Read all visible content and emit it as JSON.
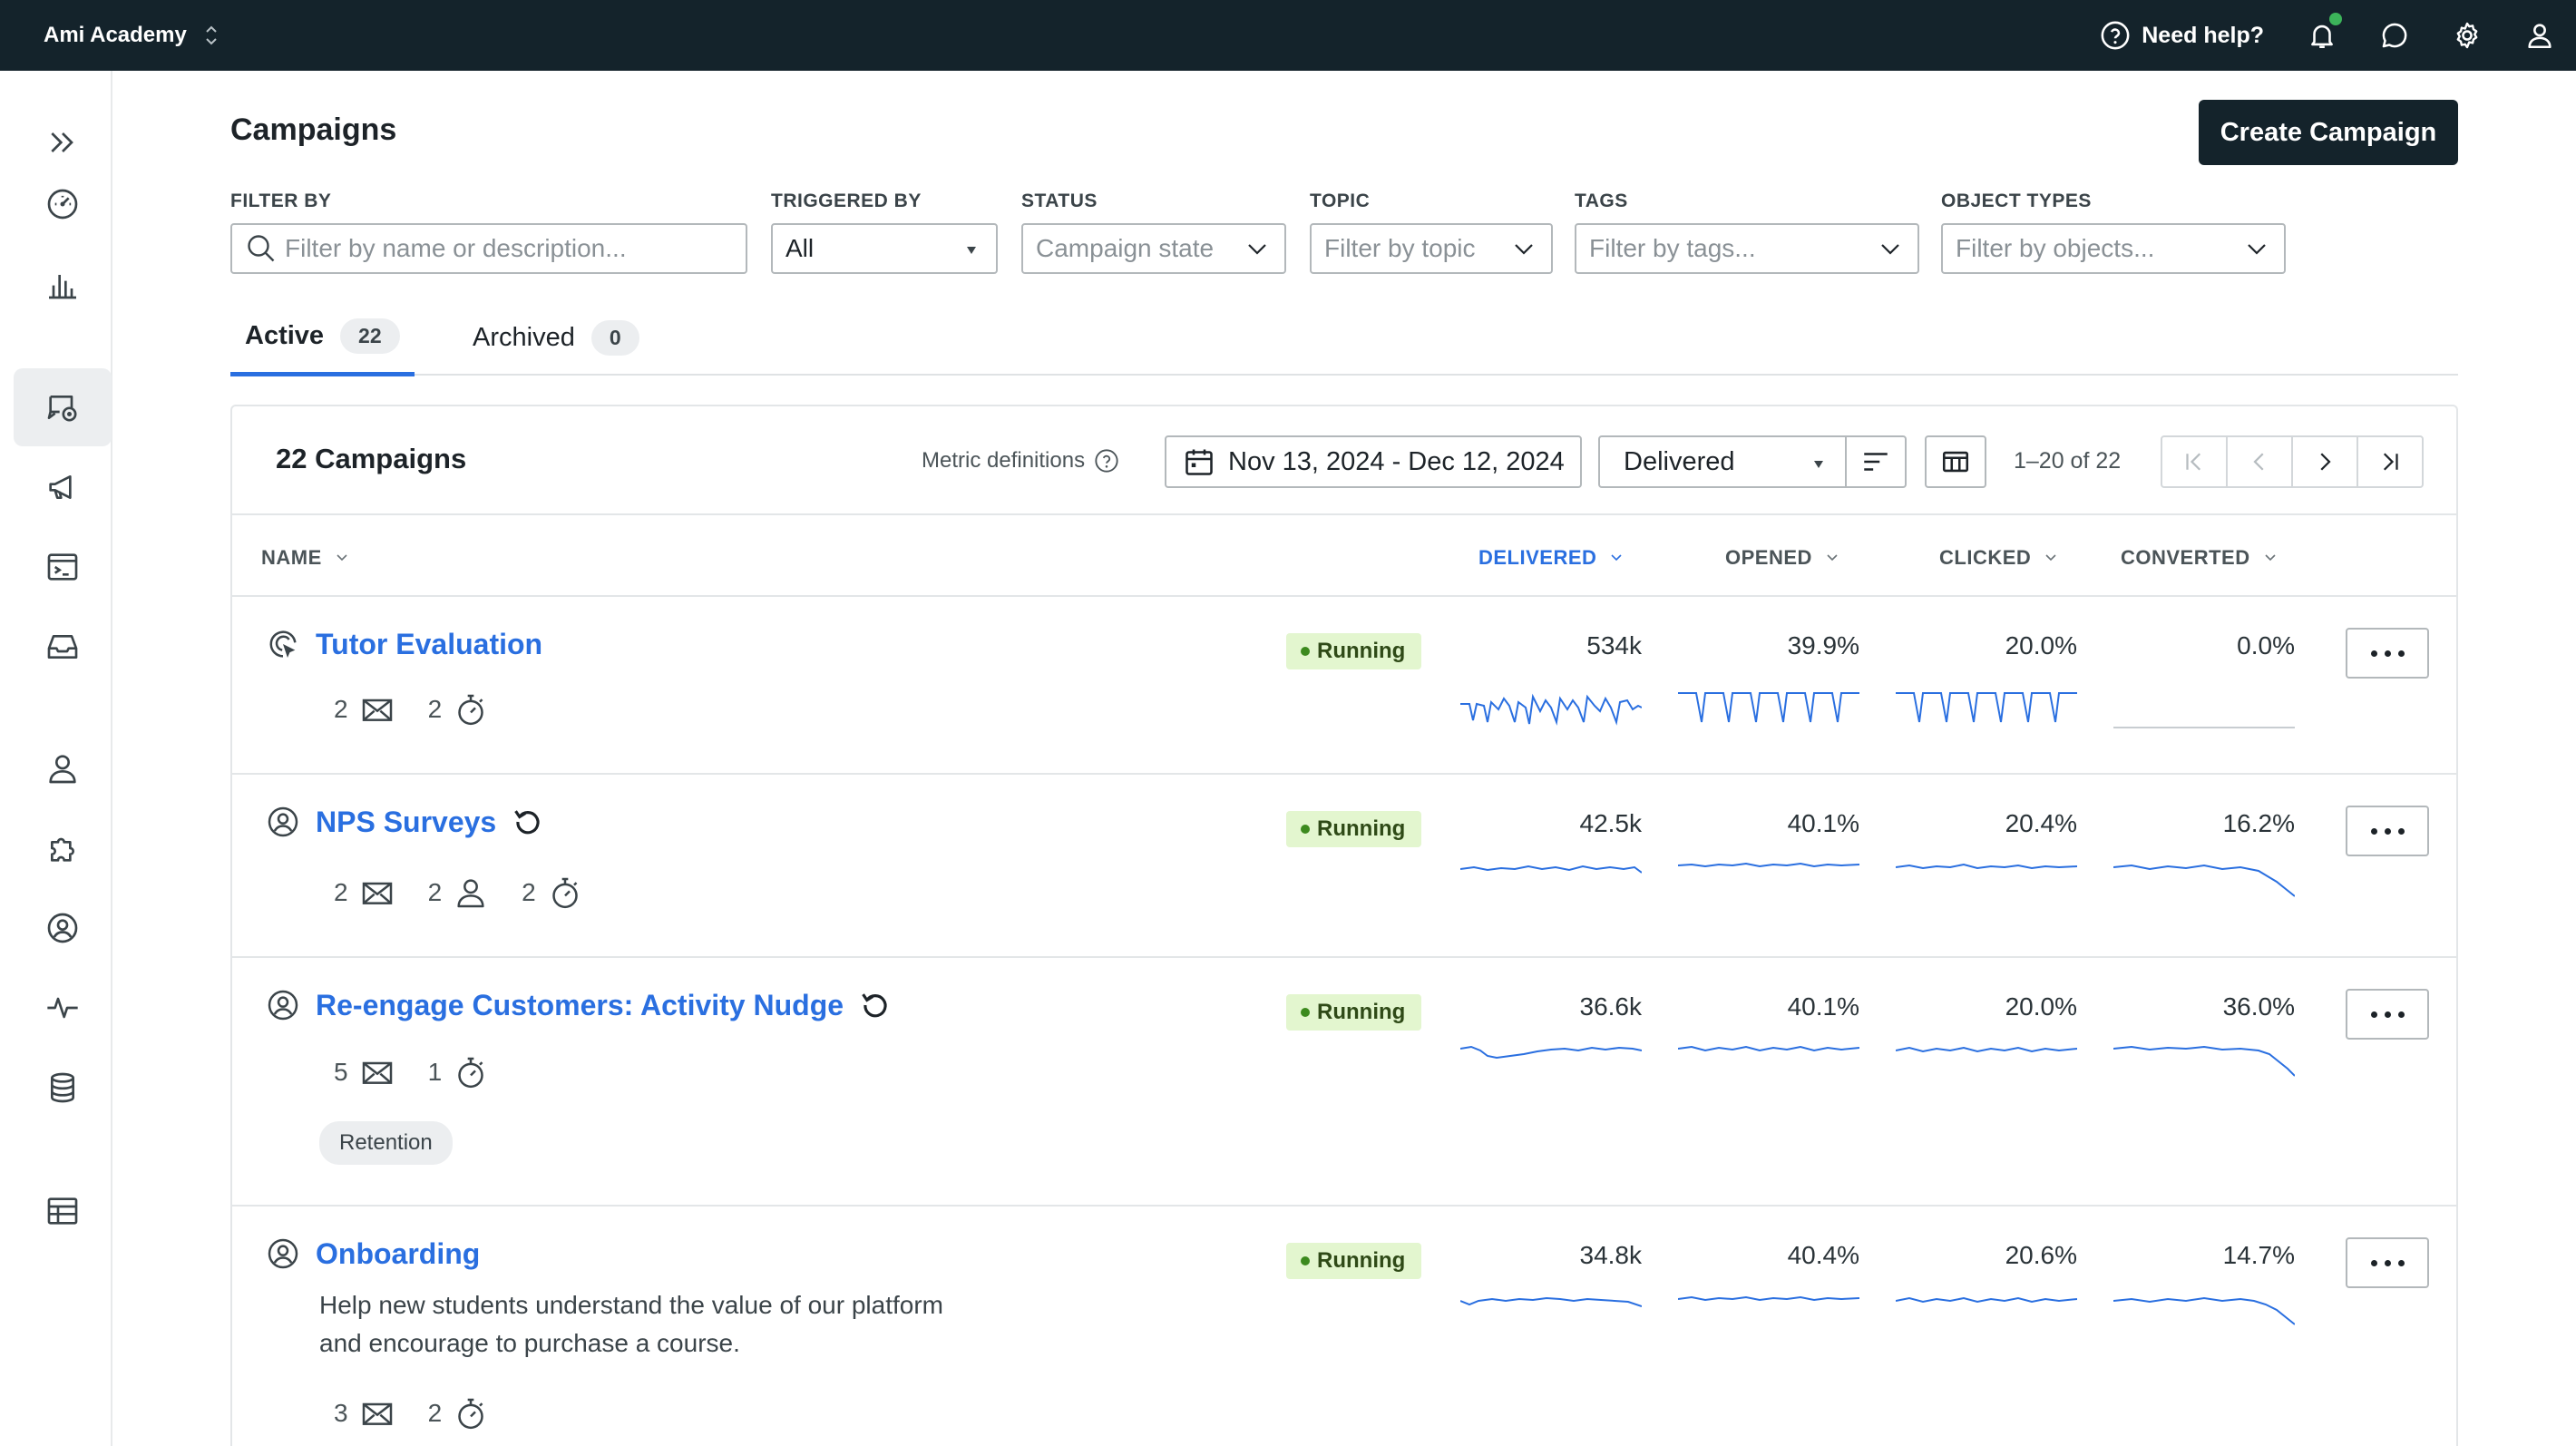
{
  "workspace": "Ami Academy",
  "topbar": {
    "help": "Need help?"
  },
  "page": {
    "title": "Campaigns",
    "create_button": "Create Campaign"
  },
  "filters": {
    "filter_by": {
      "label": "FILTER BY",
      "placeholder": "Filter by name or description..."
    },
    "triggered_by": {
      "label": "TRIGGERED BY",
      "value": "All"
    },
    "status": {
      "label": "STATUS",
      "placeholder": "Campaign state"
    },
    "topic": {
      "label": "TOPIC",
      "placeholder": "Filter by topic"
    },
    "tags": {
      "label": "TAGS",
      "placeholder": "Filter by tags..."
    },
    "object_types": {
      "label": "OBJECT TYPES",
      "placeholder": "Filter by objects..."
    }
  },
  "tabs": [
    {
      "label": "Active",
      "count": "22"
    },
    {
      "label": "Archived",
      "count": "0"
    }
  ],
  "table": {
    "title": "22 Campaigns",
    "metric_definitions": "Metric definitions",
    "date_range": "Nov 13, 2024 - Dec 12, 2024",
    "metric": "Delivered",
    "page_info": "1–20 of 22",
    "columns": {
      "name": "NAME",
      "delivered": "DELIVERED",
      "opened": "OPENED",
      "clicked": "CLICKED",
      "converted": "CONVERTED"
    }
  },
  "accent_color": "#2a6fe0",
  "status_color": "#e3f6cf",
  "rows": [
    {
      "name": "Tutor Evaluation",
      "status": "Running",
      "emails": "2",
      "people": "",
      "timers": "2",
      "delivered": "534k",
      "opened": "39.9%",
      "clicked": "20.0%",
      "converted": "0.0%"
    },
    {
      "name": "NPS Surveys",
      "status": "Running",
      "emails": "2",
      "people": "2",
      "timers": "2",
      "delivered": "42.5k",
      "opened": "40.1%",
      "clicked": "20.4%",
      "converted": "16.2%"
    },
    {
      "name": "Re-engage Customers: Activity Nudge",
      "status": "Running",
      "emails": "5",
      "people": "",
      "timers": "1",
      "tag": "Retention",
      "delivered": "36.6k",
      "opened": "40.1%",
      "clicked": "20.0%",
      "converted": "36.0%"
    },
    {
      "name": "Onboarding",
      "status": "Running",
      "description": "Help new students understand the value of our platform and encourage to purchase a course.",
      "emails": "3",
      "people": "",
      "timers": "2",
      "delivered": "34.8k",
      "opened": "40.4%",
      "clicked": "20.6%",
      "converted": "14.7%"
    }
  ]
}
